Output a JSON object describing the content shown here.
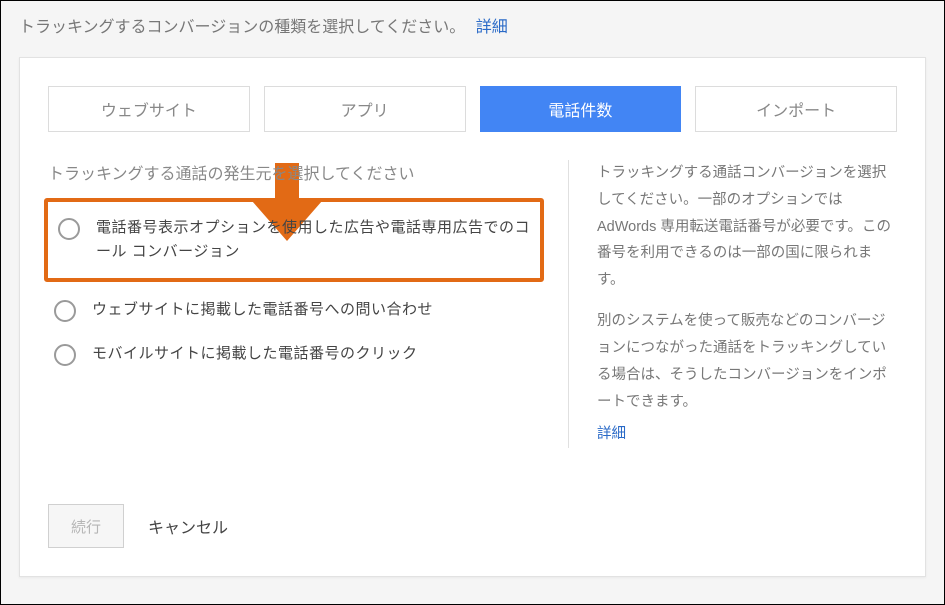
{
  "header": {
    "title": "トラッキングするコンバージョンの種類を選択してください。",
    "more_link": "詳細"
  },
  "tabs": [
    {
      "id": "website",
      "label": "ウェブサイト",
      "active": false
    },
    {
      "id": "app",
      "label": "アプリ",
      "active": false
    },
    {
      "id": "calls",
      "label": "電話件数",
      "active": true
    },
    {
      "id": "import",
      "label": "インポート",
      "active": false
    }
  ],
  "left": {
    "subtitle": "トラッキングする通話の発生元を選択してください",
    "options": [
      {
        "id": "call-ext-ads",
        "label": "電話番号表示オプションを使用した広告や電話専用広告でのコール コンバージョン",
        "highlight": true
      },
      {
        "id": "website-calls",
        "label": "ウェブサイトに掲載した電話番号への問い合わせ",
        "highlight": false
      },
      {
        "id": "mobile-clicks",
        "label": "モバイルサイトに掲載した電話番号のクリック",
        "highlight": false
      }
    ]
  },
  "right": {
    "p1": "トラッキングする通話コンバージョンを選択してください。一部のオプションでは AdWords 専用転送電話番号が必要です。この番号を利用できるのは一部の国に限られます。",
    "p2": "別のシステムを使って販売などのコンバージョンにつながった通話をトラッキングしている場合は、そうしたコンバージョンをインポートできます。",
    "more_link": "詳細"
  },
  "footer": {
    "continue": "続行",
    "cancel": "キャンセル"
  },
  "annotation": {
    "arrow_color": "#e26a15"
  }
}
